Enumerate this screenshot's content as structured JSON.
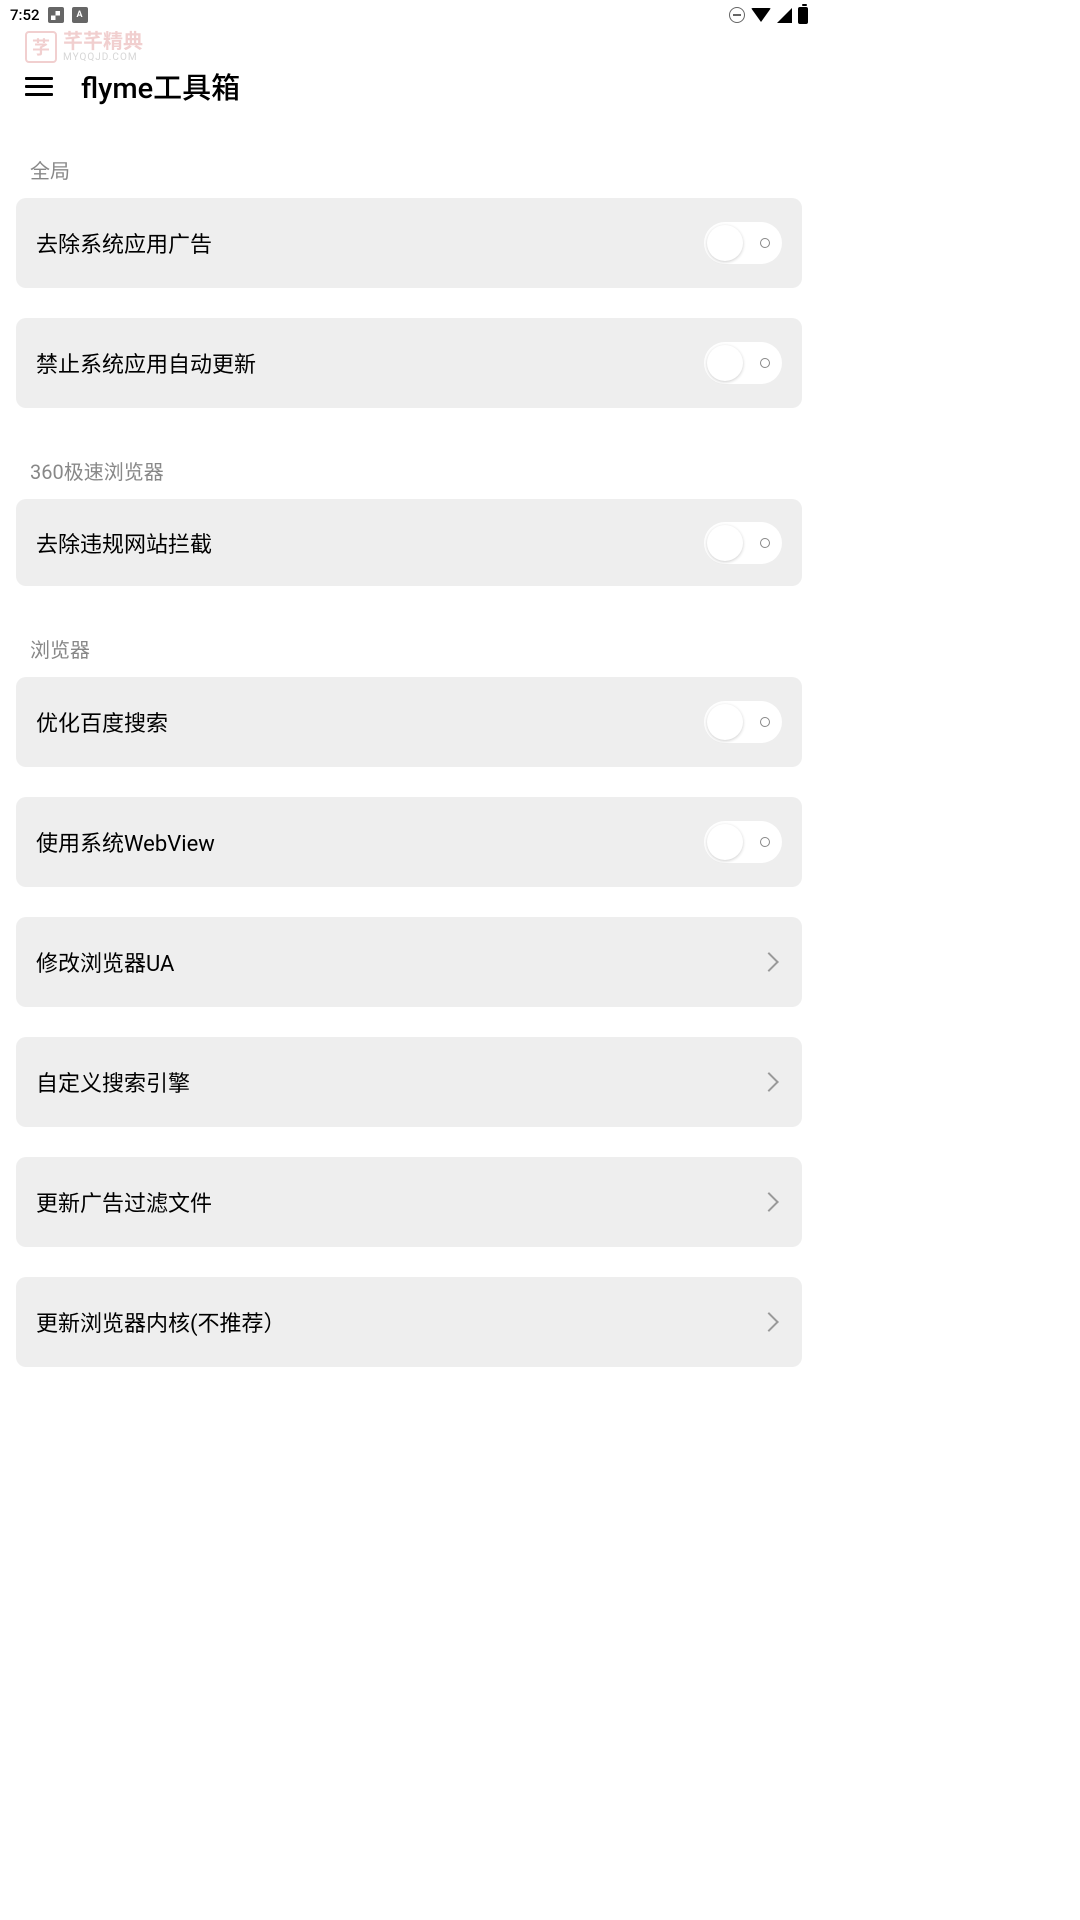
{
  "statusBar": {
    "time": "7:52"
  },
  "watermark": {
    "iconChar": "芓",
    "title": "芊芊精典",
    "subtitle": "MYQQJD.COM"
  },
  "header": {
    "title": "flyme工具箱"
  },
  "sections": [
    {
      "title": "全局",
      "items": [
        {
          "label": "去除系统应用广告",
          "type": "toggle",
          "state": false
        },
        {
          "label": "禁止系统应用自动更新",
          "type": "toggle",
          "state": false
        }
      ]
    },
    {
      "title": "360极速浏览器",
      "items": [
        {
          "label": "去除违规网站拦截",
          "type": "toggle",
          "state": false
        }
      ]
    },
    {
      "title": "浏览器",
      "items": [
        {
          "label": "优化百度搜索",
          "type": "toggle",
          "state": false
        },
        {
          "label": "使用系统WebView",
          "type": "toggle",
          "state": false
        },
        {
          "label": "修改浏览器UA",
          "type": "link"
        },
        {
          "label": "自定义搜索引擎",
          "type": "link"
        },
        {
          "label": "更新广告过滤文件",
          "type": "link"
        },
        {
          "label": "更新浏览器内核(不推荐）",
          "type": "link"
        }
      ]
    }
  ]
}
